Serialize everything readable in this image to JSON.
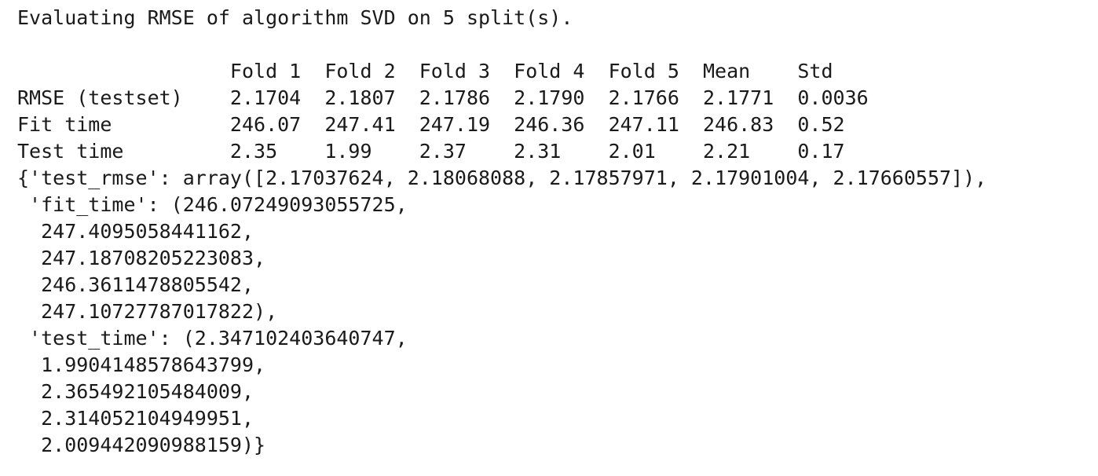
{
  "output": {
    "header_line": "Evaluating RMSE of algorithm SVD on 5 split(s).",
    "table": {
      "header_line": "                  Fold 1  Fold 2  Fold 3  Fold 4  Fold 5  Mean    Std",
      "rows": [
        "RMSE (testset)    2.1704  2.1807  2.1786  2.1790  2.1766  2.1771  0.0036",
        "Fit time          246.07  247.41  247.19  246.36  247.11  246.83  0.52",
        "Test time         2.35    1.99    2.37    2.31    2.01    2.21    0.17"
      ]
    },
    "dict_lines": [
      "{'test_rmse': array([2.17037624, 2.18068088, 2.17857971, 2.17901004, 2.17660557]),",
      " 'fit_time': (246.07249093055725,",
      "  247.4095058441162,",
      "  247.18708205223083,",
      "  246.3611478805542,",
      "  247.10727787017822),",
      " 'test_time': (2.347102403640747,",
      "  1.9904148578643799,",
      "  2.365492105484009,",
      "  2.314052104949951,",
      "  2.009442090988159)}"
    ]
  }
}
